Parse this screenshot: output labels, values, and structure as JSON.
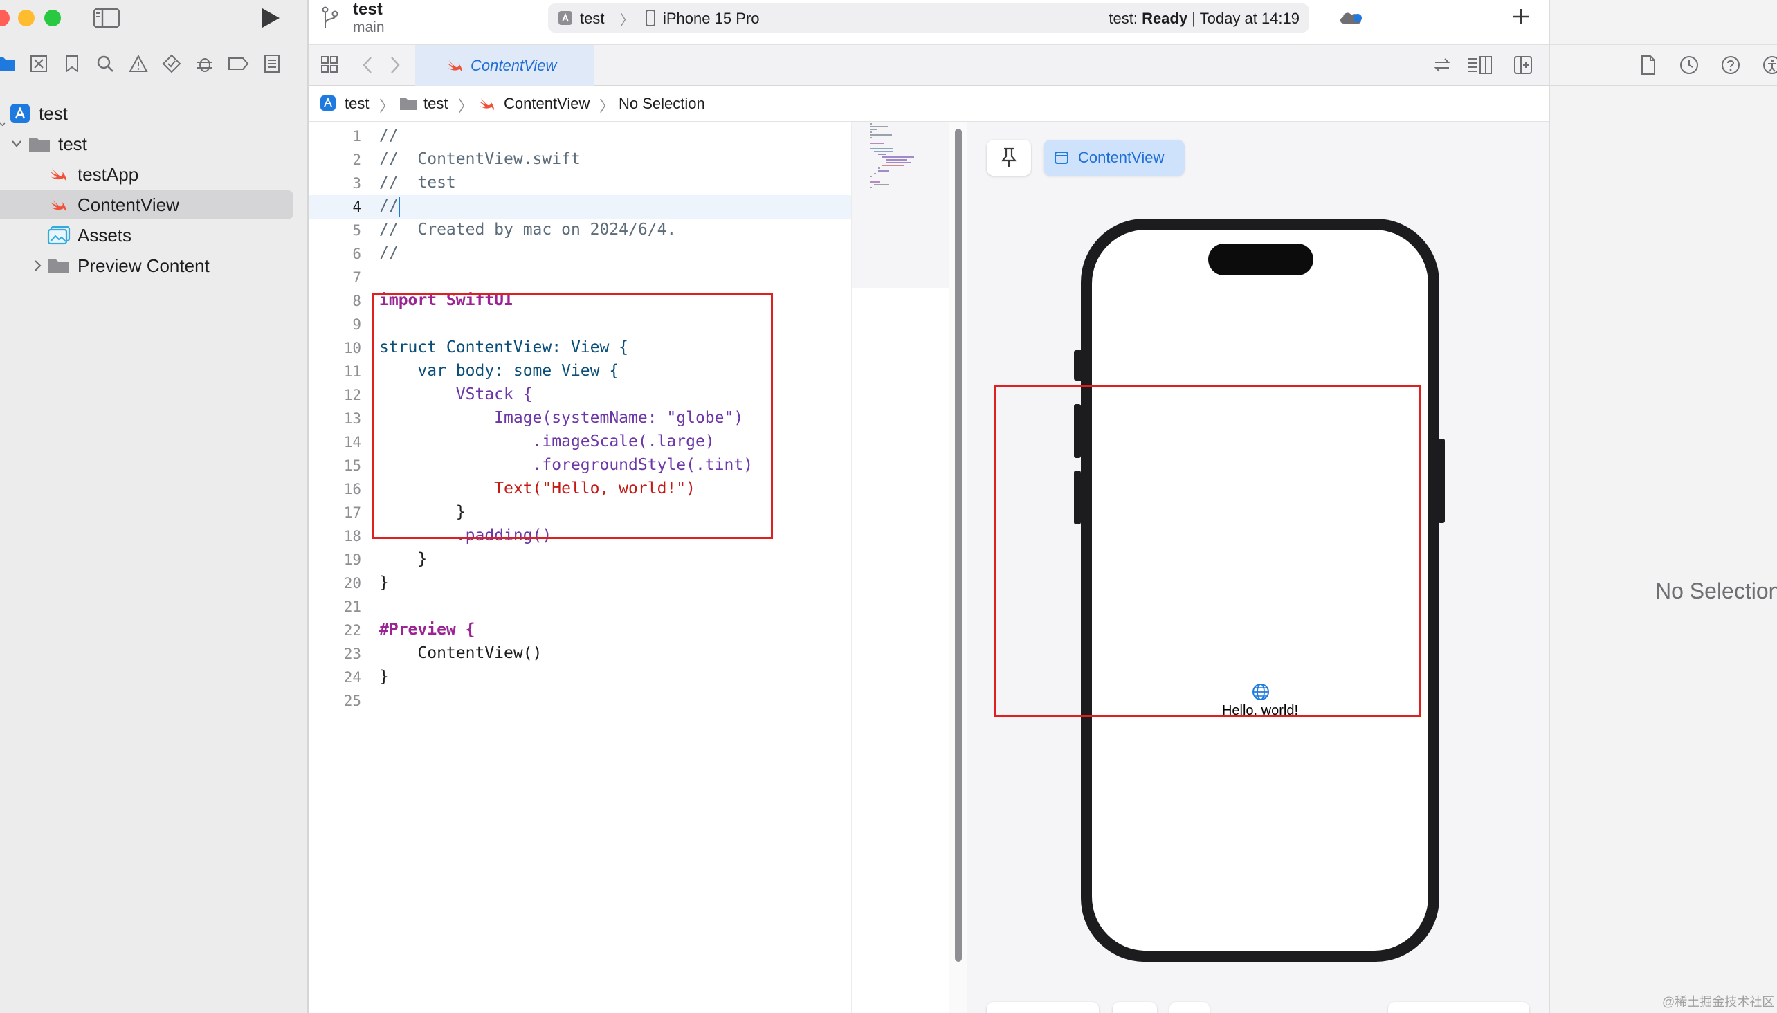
{
  "window": {
    "project_name": "test",
    "branch": "main",
    "scheme": "test",
    "destination": "iPhone 15 Pro",
    "status_prefix": "test:",
    "status_state": "Ready",
    "status_time": "| Today at 14:19"
  },
  "tab": {
    "label": "ContentView"
  },
  "navigator": {
    "items": [
      {
        "label": "test"
      },
      {
        "label": "test"
      },
      {
        "label": "testApp"
      },
      {
        "label": "ContentView"
      },
      {
        "label": "Assets"
      },
      {
        "label": "Preview Content"
      }
    ]
  },
  "jumpbar": {
    "items": [
      "test",
      "test",
      "ContentView",
      "No Selection"
    ]
  },
  "code": {
    "line_numbers": [
      "1",
      "2",
      "3",
      "4",
      "5",
      "6",
      "7",
      "8",
      "9",
      "10",
      "11",
      "12",
      "13",
      "14",
      "15",
      "16",
      "17",
      "18",
      "19",
      "20",
      "21",
      "22",
      "23",
      "24",
      "25"
    ],
    "lines": [
      "//",
      "//  ContentView.swift",
      "//  test",
      "//",
      "//  Created by mac on 2024/6/4.",
      "//",
      "",
      "import SwiftUI",
      "",
      "struct ContentView: View {",
      "    var body: some View {",
      "        VStack {",
      "            Image(systemName: \"globe\")",
      "                .imageScale(.large)",
      "                .foregroundStyle(.tint)",
      "            Text(\"Hello, world!\")",
      "        }",
      "        .padding()",
      "    }",
      "}",
      "",
      "#Preview {",
      "    ContentView()",
      "}",
      ""
    ]
  },
  "preview": {
    "chip_label": "ContentView",
    "hello_text": "Hello, world!"
  },
  "inspector": {
    "empty_text": "No Selection"
  },
  "watermark": "@稀土掘金技术社区",
  "colors": {
    "accent": "#1f7ae0",
    "highlight_box": "#e0201f"
  },
  "icons": [
    "sidebar-toggle-icon",
    "run-icon",
    "branch-icon",
    "xcode-project-icon",
    "device-icon",
    "cloud-icon",
    "plus-icon",
    "folder-icon",
    "swift-icon",
    "assets-icon",
    "pin-icon",
    "globe-icon",
    "file-icon",
    "clock-icon",
    "help-icon"
  ]
}
